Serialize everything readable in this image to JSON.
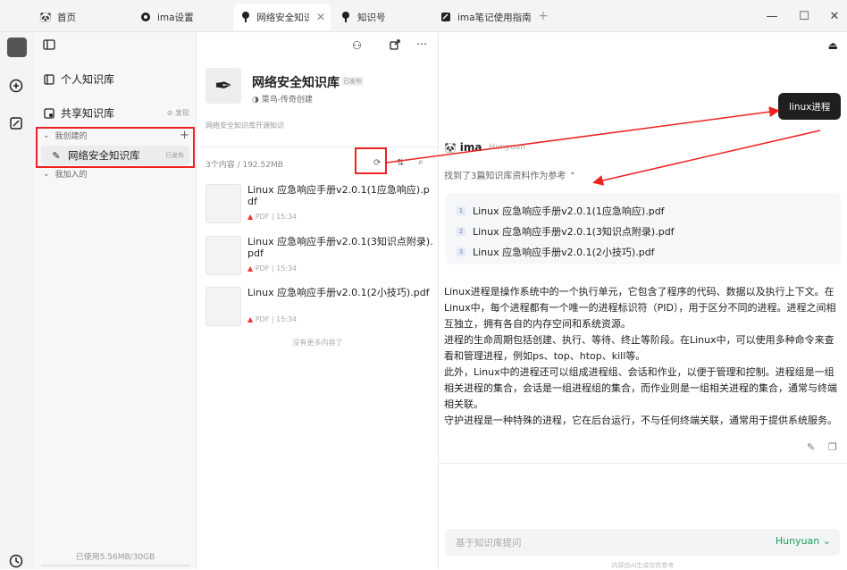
{
  "tabs": [
    {
      "label": "首页",
      "icon": "panda-icon"
    },
    {
      "label": "ima设置",
      "icon": "settings-icon"
    },
    {
      "label": "网络安全知识库",
      "icon": "pin-icon"
    },
    {
      "label": "知识号",
      "icon": "pin-icon"
    },
    {
      "label": "ima笔记使用指南",
      "icon": "note-icon"
    }
  ],
  "sidebar": {
    "personal": "个人知识库",
    "shared": "共享知识库",
    "shared_badge": "发现",
    "created_group": "我创建的",
    "kb_item": "网络安全知识库",
    "kb_badge": "已发布",
    "joined_group": "我加入的",
    "storage": "已使用5.56MB/30GB"
  },
  "kb": {
    "title": "网络安全知识库",
    "title_badge": "已发布",
    "author": "菜鸟-传奇创建",
    "desc": "网络安全知识库开源知识",
    "count": "3个内容 / 192.52MB",
    "docs": [
      {
        "name": "Linux 应急响应手册v2.0.1(1应急响应).pdf",
        "type": "PDF",
        "time": "15:34"
      },
      {
        "name": "Linux 应急响应手册v2.0.1(3知识点附录).pdf",
        "type": "PDF",
        "time": "15:34"
      },
      {
        "name": "Linux 应急响应手册v2.0.1(2小技巧).pdf",
        "type": "PDF",
        "time": "15:34"
      }
    ],
    "no_more": "没有更多内容了"
  },
  "chat": {
    "user_message": "linux进程",
    "bot_name": "ima",
    "model_tag": "Hunyuan",
    "ref_summary": "找到了3篇知识库资料作为参考",
    "refs": [
      "Linux 应急响应手册v2.0.1(1应急响应).pdf",
      "Linux 应急响应手册v2.0.1(3知识点附录).pdf",
      "Linux 应急响应手册v2.0.1(2小技巧).pdf"
    ],
    "answer": [
      "Linux进程是操作系统中的一个执行单元，它包含了程序的代码、数据以及执行上下文。在Linux中，每个进程都有一个唯一的进程标识符（PID），用于区分不同的进程。进程之间相互独立，拥有各自的内存空间和系统资源。",
      "进程的生命周期包括创建、执行、等待、终止等阶段。在Linux中，可以使用多种命令来查看和管理进程，例如ps、top、htop、kill等。",
      "此外，Linux中的进程还可以组成进程组、会话和作业，以便于管理和控制。进程组是一组相关进程的集合，会话是一组进程组的集合，而作业则是一组相关进程的集合，通常与终端相关联。",
      "守护进程是一种特殊的进程，它在后台运行，不与任何终端关联，通常用于提供系统服务。"
    ],
    "input_placeholder": "基于知识库提问",
    "model_select": "Hunyuan",
    "footer_note": "内容由AI生成仅供参考"
  },
  "colors": {
    "accent": "#1a9f5a",
    "annotation": "#e22222"
  }
}
